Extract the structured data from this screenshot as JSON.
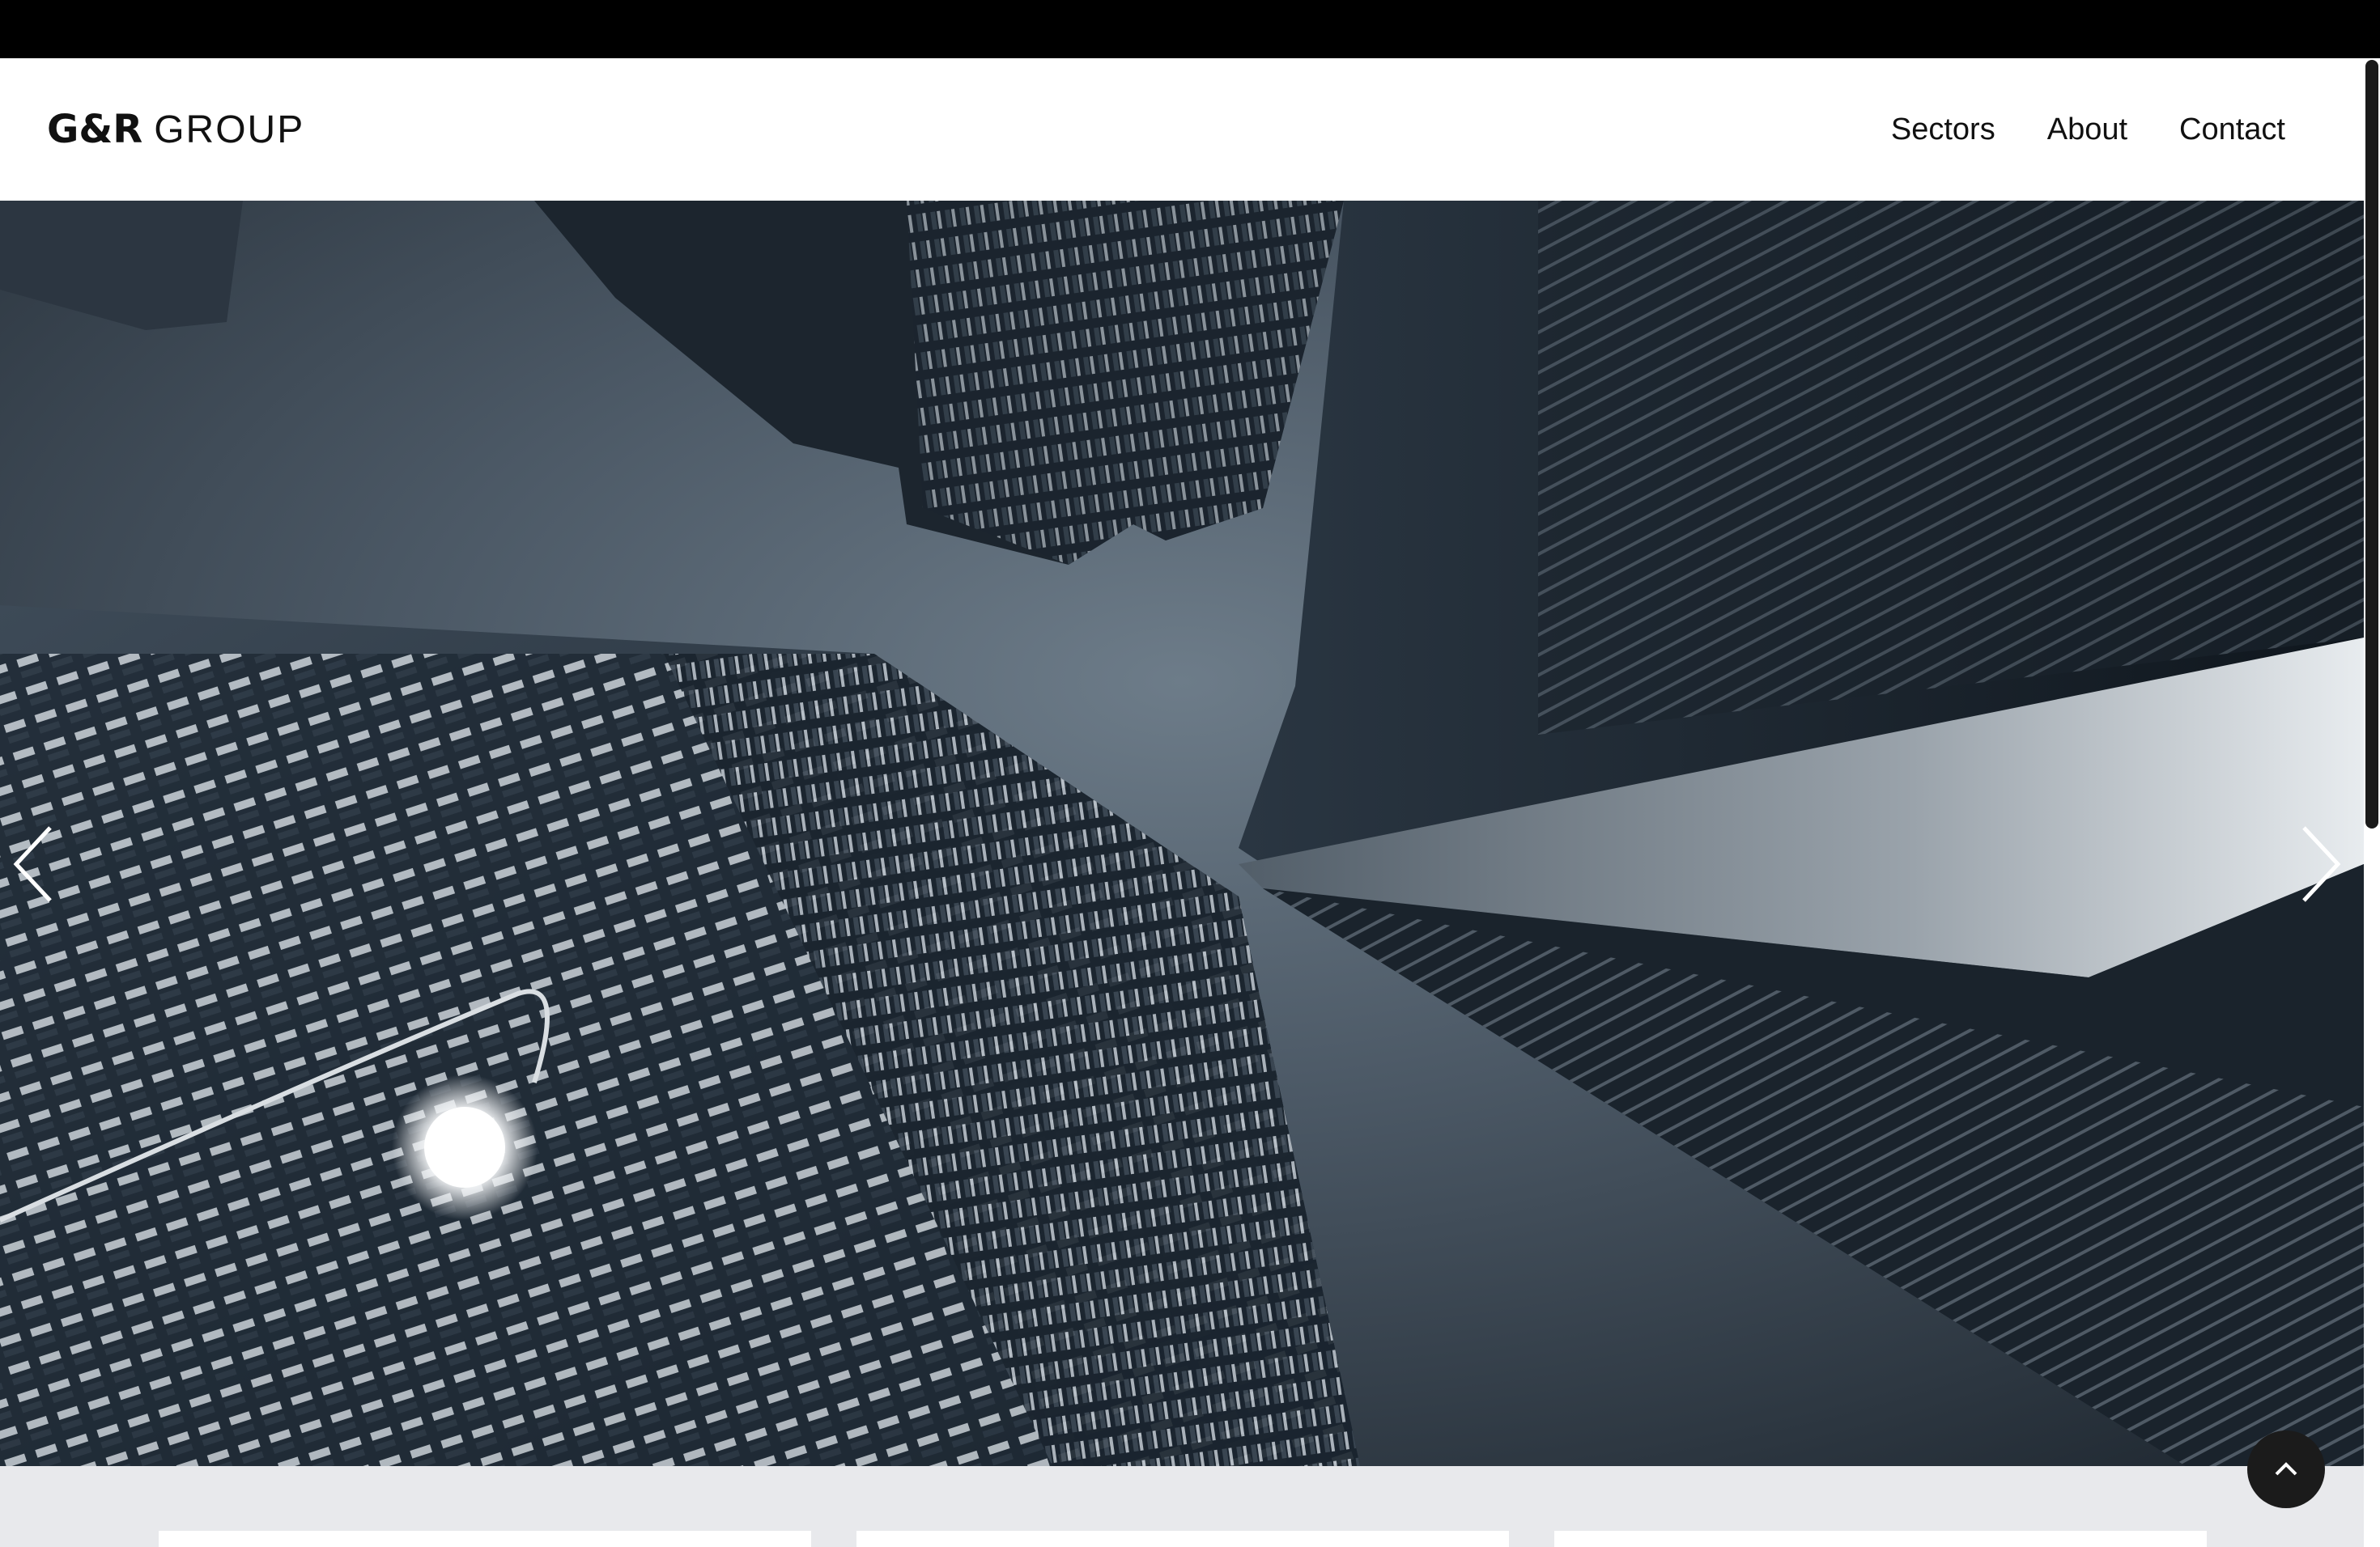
{
  "brand": {
    "name_bold": "G&R",
    "name_light": "GROUP"
  },
  "nav": {
    "items": [
      "Sectors",
      "About",
      "Contact"
    ]
  },
  "hero": {
    "image_description_icon": "skyscrapers-photo",
    "prev_icon": "chevron-left-icon",
    "next_icon": "chevron-right-icon"
  },
  "back_to_top_icon": "chevron-up-icon",
  "colors": {
    "header_bg": "#ffffff",
    "page_bg": "#e8e9ec",
    "text": "#111111",
    "back_to_top_bg": "#1b1b1b"
  }
}
